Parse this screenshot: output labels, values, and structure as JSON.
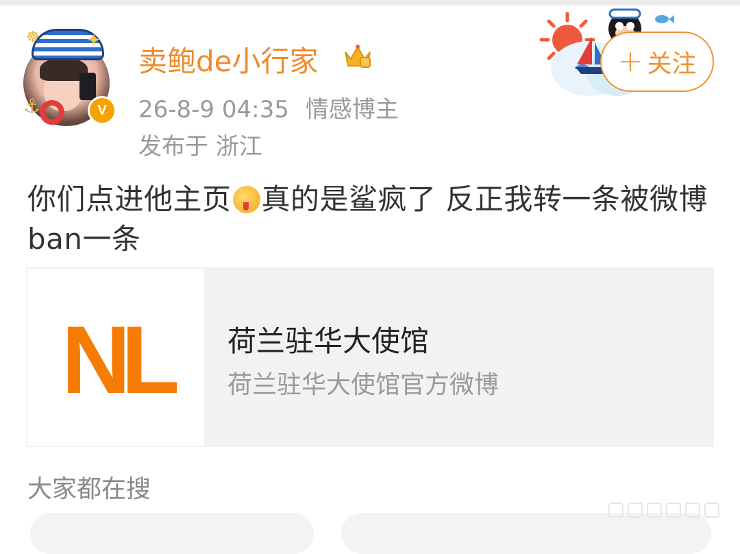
{
  "post": {
    "author": {
      "name": "卖鲍de小行家"
    },
    "time": "26-8-9 04:35",
    "tag": "情感博主",
    "location": "发布于 浙江",
    "follow_label": "关注",
    "text_part1": "你们点进他主页",
    "text_part2": "真的是鲨疯了 反正我转一条被微博ban一条",
    "link_card": {
      "logo_text": "NL",
      "title": "荷兰驻华大使馆",
      "subtitle": "荷兰驻华大使馆官方微博"
    }
  },
  "search": {
    "label": "大家都在搜"
  },
  "colors": {
    "username": "#f08a2c",
    "follow": "#f0912f",
    "logo": "#f57c00",
    "verified": "#f6a200"
  },
  "icons": {
    "verified": "verified-v-badge",
    "crown": "vip-crown-icon",
    "emoji": "drooling-face-emoji"
  }
}
